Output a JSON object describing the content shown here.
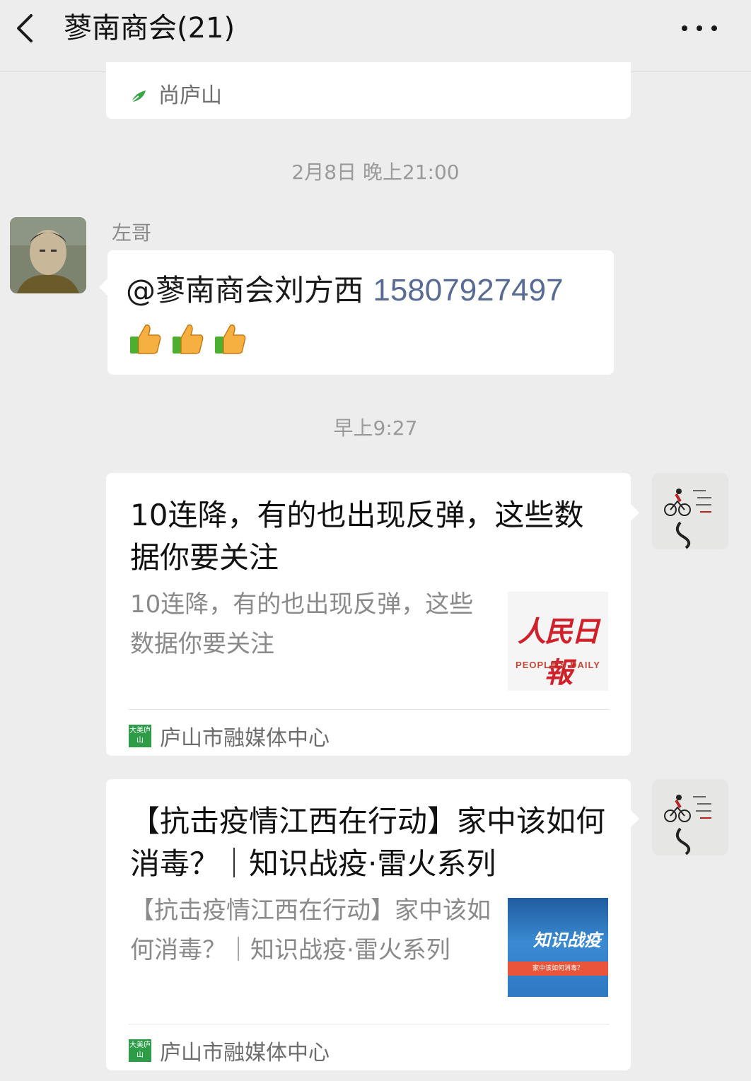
{
  "header": {
    "title": "蓼南商会(21)"
  },
  "prev_card": {
    "source": "尚庐山"
  },
  "timestamps": {
    "first": "2月8日 晚上21:00",
    "second": "早上9:27"
  },
  "message": {
    "sender": "左哥",
    "mention": "@蓼南商会刘方西 ",
    "phone": "15807927497",
    "emoji_icon": "thumbs-up-icon"
  },
  "articles": [
    {
      "title": "10连降，有的也出现反弹，这些数据你要关注",
      "desc": "10连降，有的也出现反弹，这些数据你要关注",
      "thumb_cn": "人民日報",
      "thumb_en": "PEOPLE'S DAILY",
      "source": "庐山市融媒体中心",
      "source_icon_text": "大美庐山"
    },
    {
      "title": "【抗击疫情江西在行动】家中该如何消毒？｜知识战疫·雷火系列",
      "desc": "【抗击疫情江西在行动】家中该如何消毒？｜知识战疫·雷火系列",
      "thumb_text": "知识战疫",
      "thumb_strip": "家中该如何消毒？",
      "source": "庐山市融媒体中心",
      "source_icon_text": "大美庐山"
    }
  ]
}
